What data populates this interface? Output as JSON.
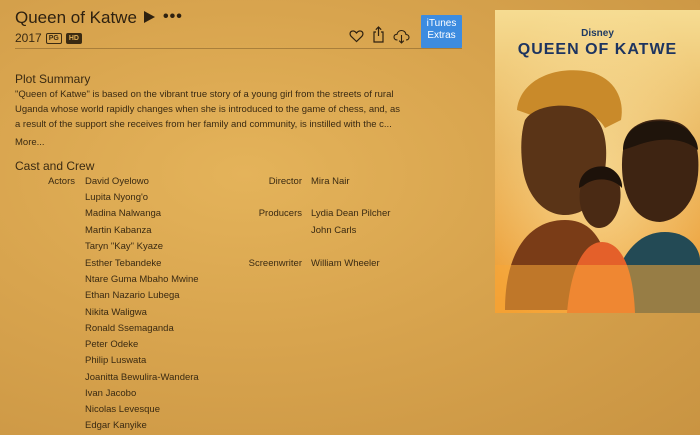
{
  "movie": {
    "title": "Queen of Katwe",
    "year": "2017",
    "rating_badge": "PG",
    "quality_badge": "HD"
  },
  "actions": {
    "extras_line1": "iTunes",
    "extras_line2": "Extras"
  },
  "plot": {
    "heading": "Plot Summary",
    "lines": [
      "\"Queen of Katwe\" is based on the vibrant true story of a young girl from the streets of rural",
      "Uganda whose world rapidly changes when she is introduced to the game of chess, and, as",
      "a result of the support she receives from her family and community, is instilled with the c..."
    ],
    "more": "More..."
  },
  "cast": {
    "heading": "Cast and Crew",
    "actors_label": "Actors",
    "actors": [
      "David Oyelowo",
      "Lupita Nyong'o",
      "Madina Nalwanga",
      "Martin Kabanza",
      "Taryn \"Kay\" Kyaze",
      "Esther Tebandeke",
      "Ntare Guma Mbaho Mwine",
      "Ethan Nazario Lubega",
      "Nikita Waligwa",
      "Ronald Ssemaganda",
      "Peter Odeke",
      "Philip Luswata",
      "Joanitta Bewulira-Wandera",
      "Ivan Jacobo",
      "Nicolas Levesque",
      "Edgar Kanyike"
    ],
    "director_label": "Director",
    "director": "Mira Nair",
    "producers_label": "Producers",
    "producers": [
      "Lydia Dean Pilcher",
      "John Carls"
    ],
    "screenwriter_label": "Screenwriter",
    "screenwriter": "William Wheeler"
  },
  "poster": {
    "studio": "Disney",
    "title": "QUEEN OF KATWE"
  },
  "colors": {
    "background": "#d8a44e",
    "extras_button": "#3d8ce0",
    "text": "#3a2a12"
  },
  "icons": [
    "play-icon",
    "more-icon",
    "heart-icon",
    "share-icon",
    "download-icon"
  ]
}
